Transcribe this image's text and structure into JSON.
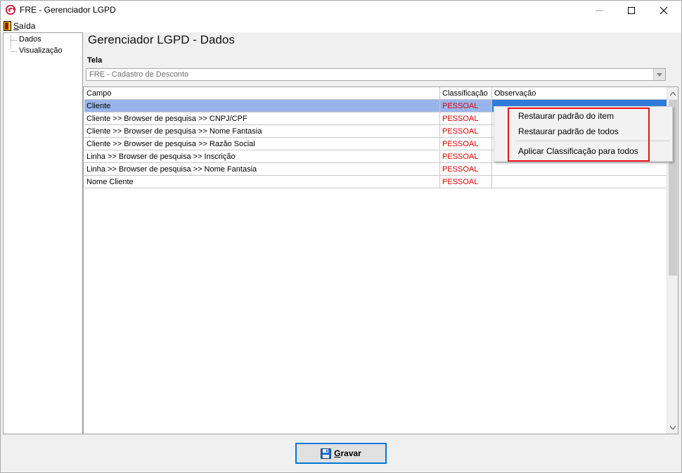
{
  "window": {
    "title": "FRE - Gerenciador LGPD",
    "icon": "app-logo-icon",
    "controls": [
      "minimize-icon",
      "maximize-icon",
      "close-icon"
    ]
  },
  "menu": {
    "saida_first": "S",
    "saida_rest": "aída"
  },
  "tree": {
    "items": [
      "Dados",
      "Visualização"
    ]
  },
  "page": {
    "title": "Gerenciador LGPD - Dados",
    "tela_label": "Tela",
    "tela_value": "FRE - Cadastro de Desconto"
  },
  "grid": {
    "columns": [
      "Campo",
      "Classificação",
      "Observação"
    ],
    "rows": [
      {
        "campo": "Cliente",
        "classificacao": "PESSOAL",
        "observacao": ""
      },
      {
        "campo": "Cliente >> Browser de pesquisa >> CNPJ/CPF",
        "classificacao": "PESSOAL",
        "observacao": ""
      },
      {
        "campo": "Cliente >> Browser de pesquisa >> Nome Fantasia",
        "classificacao": "PESSOAL",
        "observacao": ""
      },
      {
        "campo": "Cliente >> Browser de pesquisa >> Razão Social",
        "classificacao": "PESSOAL",
        "observacao": ""
      },
      {
        "campo": "Linha >> Browser de pesquisa >> Inscrição",
        "classificacao": "PESSOAL",
        "observacao": ""
      },
      {
        "campo": "Linha >> Browser de pesquisa >> Nome Fantasia",
        "classificacao": "PESSOAL",
        "observacao": ""
      },
      {
        "campo": "Nome Cliente",
        "classificacao": "PESSOAL",
        "observacao": ""
      }
    ],
    "selected_row": 0
  },
  "context_menu": {
    "items": [
      "Restaurar padrão do item",
      "Restaurar padrão de todos",
      "Aplicar Classificação para todos"
    ]
  },
  "footer": {
    "gravar_first": "G",
    "gravar_rest": "ravar"
  },
  "colors": {
    "selection": "#99b4ea",
    "selection_active": "#2f7bd8",
    "classification_text": "#e00000",
    "highlight_box": "#e8101c",
    "button_border": "#0078d7"
  }
}
